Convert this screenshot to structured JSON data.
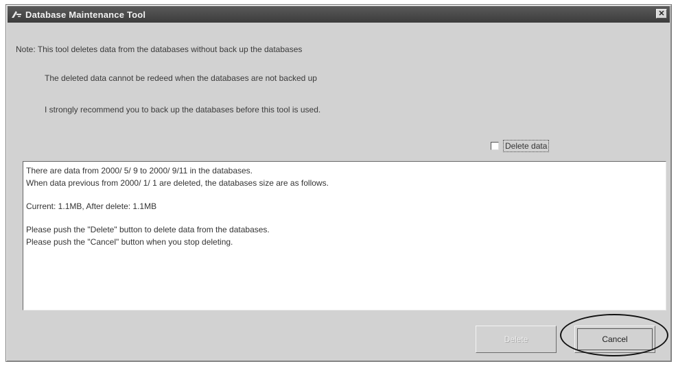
{
  "window": {
    "title": "Database Maintenance Tool",
    "close_glyph": "✕"
  },
  "notes": [
    "Note: This tool deletes data from the databases without back up the databases",
    "The deleted data cannot be redeed when the databases are not backed up",
    "I strongly recommend you to back up the databases before this tool is used."
  ],
  "delete_checkbox": {
    "label": "Delete data",
    "checked": false
  },
  "info_text": {
    "line1": "There are data from 2000/ 5/ 9 to 2000/ 9/11 in the databases.",
    "line2": "When data previous from 2000/ 1/ 1 are deleted, the databases size are as follows.",
    "line3": "Current:  1.1MB,  After delete:  1.1MB",
    "line4": "Please push the \"Delete\" button to delete data from the databases.",
    "line5": "Please push the \"Cancel\" button when you stop deleting."
  },
  "buttons": {
    "delete_label": "Delete",
    "delete_enabled": false,
    "cancel_label": "Cancel"
  },
  "colors": {
    "titlebar": "#3c3c3c",
    "dialog_bg": "#d2d2d2"
  }
}
